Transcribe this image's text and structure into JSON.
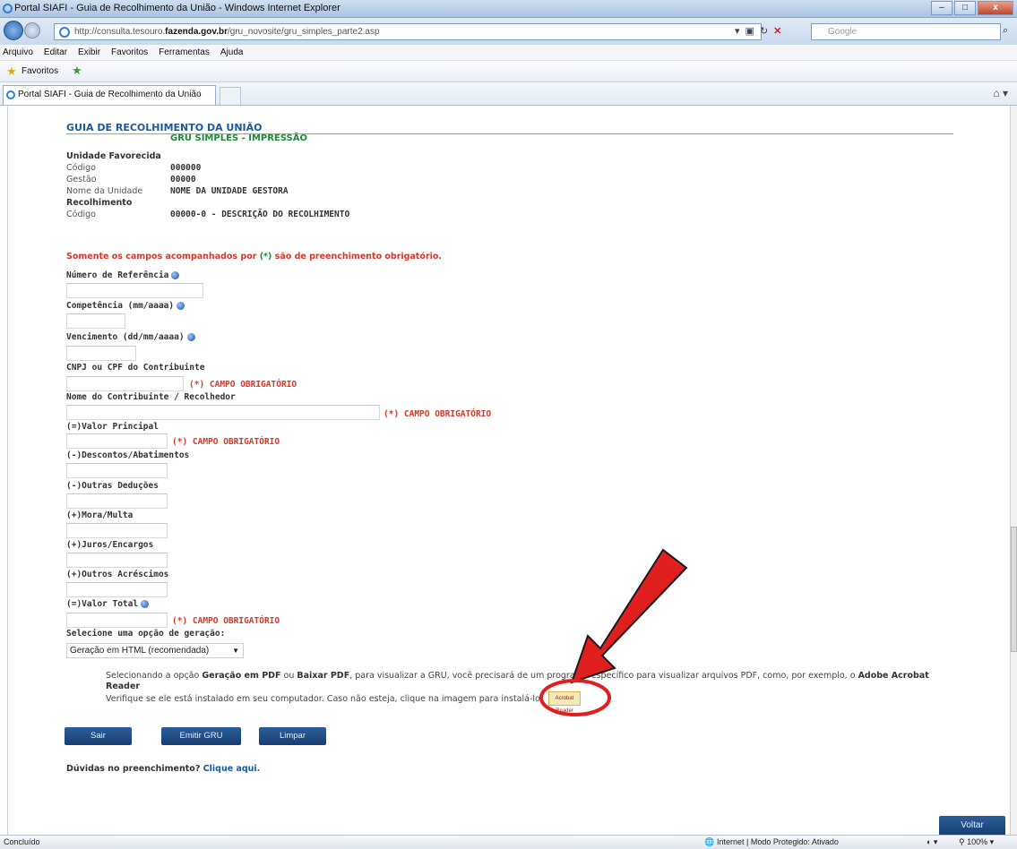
{
  "window": {
    "title": "Portal SIAFI - Guia de Recolhimento da União - Windows Internet Explorer"
  },
  "browser": {
    "url_prefix": "http://consulta.tesouro.",
    "url_domain": "fazenda.gov.br",
    "url_path": "/gru_novosite/gru_simples_parte2.asp",
    "search_placeholder": "Google",
    "menu": [
      "Arquivo",
      "Editar",
      "Exibir",
      "Favoritos",
      "Ferramentas",
      "Ajuda"
    ],
    "favorites_label": "Favoritos",
    "tab_title": "Portal SIAFI - Guia de Recolhimento da União"
  },
  "page": {
    "title": "GUIA DE RECOLHIMENTO DA UNIÃO",
    "subtitle": "GRU SIMPLES - IMPRESSÃO",
    "unidade_header": "Unidade Favorecida",
    "codigo_label": "Código",
    "codigo_value": "000000",
    "gestao_label": "Gestão",
    "gestao_value": "00000",
    "nome_unidade_label": "Nome da Unidade",
    "nome_unidade_value": "NOME DA UNIDADE GESTORA",
    "recolhimento_header": "Recolhimento",
    "rec_codigo_label": "Código",
    "rec_codigo_value": "00000-0 - DESCRIÇÃO DO RECOLHIMENTO",
    "warning_pre": "Somente os campos acompanhados por ",
    "warning_ast": "(*)",
    "warning_post": " são de preenchimento obrigatório.",
    "fields": {
      "numero_referencia": "Número de Referência",
      "competencia": "Competência (mm/aaaa)",
      "vencimento": "Vencimento (dd/mm/aaaa)",
      "cnpj_cpf": "CNPJ ou CPF do Contribuinte",
      "nome_contribuinte": "Nome do Contribuinte / Recolhedor",
      "valor_principal": "(=)Valor Principal",
      "descontos": "(-)Descontos/Abatimentos",
      "outras_deducoes": "(-)Outras Deduções",
      "mora_multa": "(+)Mora/Multa",
      "juros": "(+)Juros/Encargos",
      "outros_acrescimos": "(+)Outros Acréscimos",
      "valor_total": "(=)Valor Total"
    },
    "required_label": "(*) CAMPO OBRIGATÓRIO",
    "geracao_label": "Selecione uma opção de geração:",
    "geracao_selected": "Geração em HTML (recomendada)",
    "info_line1_a": "Selecionando a opção ",
    "info_line1_b": "Geração em PDF",
    "info_line1_c": " ou ",
    "info_line1_d": "Baixar PDF",
    "info_line1_e": ", para visualizar a GRU, você precisará de um programa específico para visualizar arquivos PDF, como, por exemplo, o ",
    "info_line1_f": "Adobe Acrobat",
    "info_line2": "Reader",
    "info_line3": "Verifique se ele está instalado em seu computador. Caso não esteja, clique na imagem para instalá-lo.",
    "acrobat_badge": "Acrobat Reader",
    "buttons": {
      "sair": "Sair",
      "emitir": "Emitir GRU",
      "limpar": "Limpar",
      "voltar": "Voltar"
    },
    "duvidas": "Dúvidas no preenchimento?",
    "duvidas_link": "Clique aqui."
  },
  "status": {
    "left": "Concluído",
    "zone": "Internet | Modo Protegido: Ativado",
    "zoom": "100%"
  },
  "colors": {
    "title_blue": "#1a5a9c",
    "subtitle_green": "#1c8c34",
    "required_red": "#d23a2a",
    "button_blue": "#1f4a80",
    "annotation_red": "#e01f1f"
  }
}
